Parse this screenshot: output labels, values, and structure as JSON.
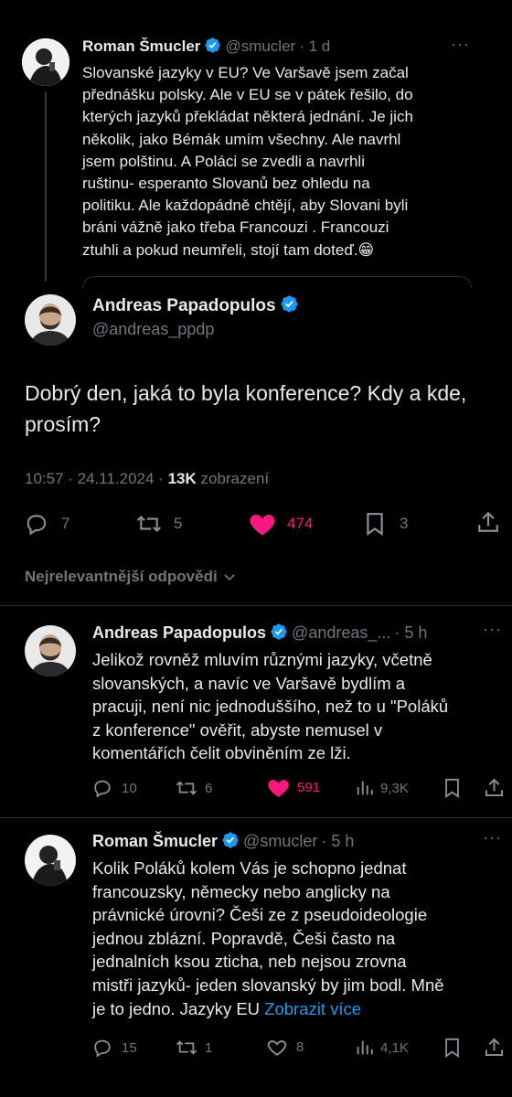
{
  "quoted_tweet": {
    "name": "Roman Šmucler",
    "handle": "@smucler",
    "time": "· 1 d",
    "lines": [
      "Slovanské jazyky v EU? Ve Varšavě jsem začal",
      "přednášku polsky. Ale v EU se v pátek řešilo, do",
      "kterých jazyků překládat některá jednání. Je jich",
      "několik, jako Bémák umím všechny. Ale navrhl",
      "jsem polštinu. A Poláci se zvedli a navrhli",
      "ruštinu- esperanto Slovanů bez ohledu na",
      "politiku. Ale každopádně chtějí, aby Slovani byli",
      "bráni vážně jako třeba Francouzi . Francouzi",
      "ztuhli a pokud neumřeli, stojí tam doteď.😁"
    ]
  },
  "main_tweet": {
    "name": "Andreas Papadopulos",
    "handle": "@andreas_ppdp",
    "text_line1": "Dobrý den, jaká to byla konference? Kdy a kde,",
    "text_line2": "prosím?",
    "timestamp": "10:57 · 24.11.2024 · ",
    "views_count": "13K",
    "views_label": " zobrazení",
    "replies": "7",
    "reposts": "5",
    "likes": "474",
    "bookmarks": "3",
    "like_color": "#f91880"
  },
  "sort_label": "Nejrelevantnější odpovědi",
  "replies": [
    {
      "name": "Andreas Papadopulos",
      "handle": "@andreas_...",
      "time": "· 5 h",
      "lines": [
        "Jelikož rovněž mluvím různými jazyky, včetně",
        "slovanských, a navíc ve Varšavě bydlím a",
        "pracuji, není nic jednoduššího, než to u \"Poláků",
        "z konference\" ověřit, abyste nemusel v",
        "komentářích čelit obviněním ze lži."
      ],
      "replies": "10",
      "reposts": "6",
      "likes": "591",
      "views": "9,3K"
    },
    {
      "name": "Roman Šmucler",
      "handle": "@smucler",
      "time": "· 5 h",
      "lines": [
        "Kolik Poláků kolem Vás je schopno jednat",
        "francouzsky, německy nebo anglicky na",
        "právnické úrovni? Češi ze z pseudoideologie",
        "jednou zblázní. Popravdě, Češi často na",
        "jednalních ksou zticha, neb nejsou zrovna",
        "mistři jazyků- jeden slovanský by jim bodl. Mně"
      ],
      "last_line": "je to jedno. Jazyky EU ",
      "show_more": "Zobrazit více",
      "replies": "15",
      "reposts": "1",
      "likes": "8",
      "views": "4,1K"
    }
  ],
  "colors": {
    "accent": "#1d9bf0",
    "like": "#f91880",
    "muted": "#71767b"
  }
}
